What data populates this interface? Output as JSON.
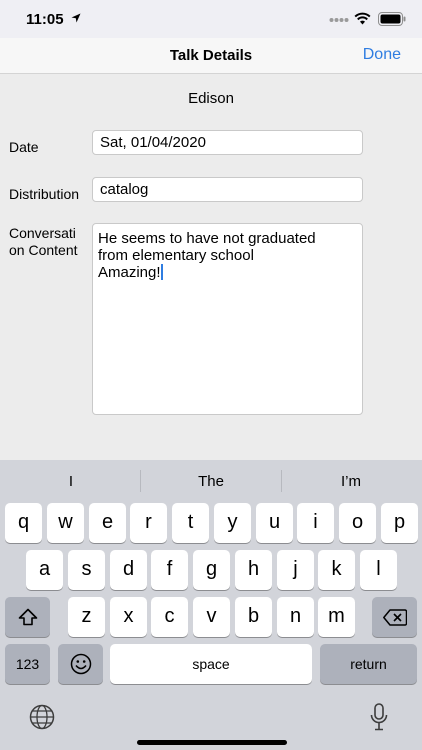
{
  "status_bar": {
    "time": "11:05"
  },
  "nav": {
    "title": "Talk Details",
    "done_label": "Done"
  },
  "form": {
    "person_name": "Edison",
    "date_label": "Date",
    "date_value": "Sat, 01/04/2020",
    "distribution_label": "Distribution",
    "distribution_value": "catalog",
    "content_label_line1": "Conversati",
    "content_label_line2": "on Content",
    "content_value": "He seems to have not graduated\nfrom elementary school\nAmazing!"
  },
  "keyboard": {
    "suggestions": [
      "I",
      "The",
      "I’m"
    ],
    "row1": [
      "q",
      "w",
      "e",
      "r",
      "t",
      "y",
      "u",
      "i",
      "o",
      "p"
    ],
    "row2": [
      "a",
      "s",
      "d",
      "f",
      "g",
      "h",
      "j",
      "k",
      "l"
    ],
    "row3": [
      "z",
      "x",
      "c",
      "v",
      "b",
      "n",
      "m"
    ],
    "numbers_label": "123",
    "space_label": "space",
    "return_label": "return"
  },
  "colors": {
    "accent": "#2f7de1",
    "keyboard_bg": "#d2d4da",
    "key_dark": "#adb1bb"
  },
  "icons": [
    "location-arrow-icon",
    "signal-dots-icon",
    "wifi-icon",
    "battery-icon",
    "shift-icon",
    "backspace-icon",
    "emoji-icon",
    "globe-icon",
    "microphone-icon"
  ]
}
